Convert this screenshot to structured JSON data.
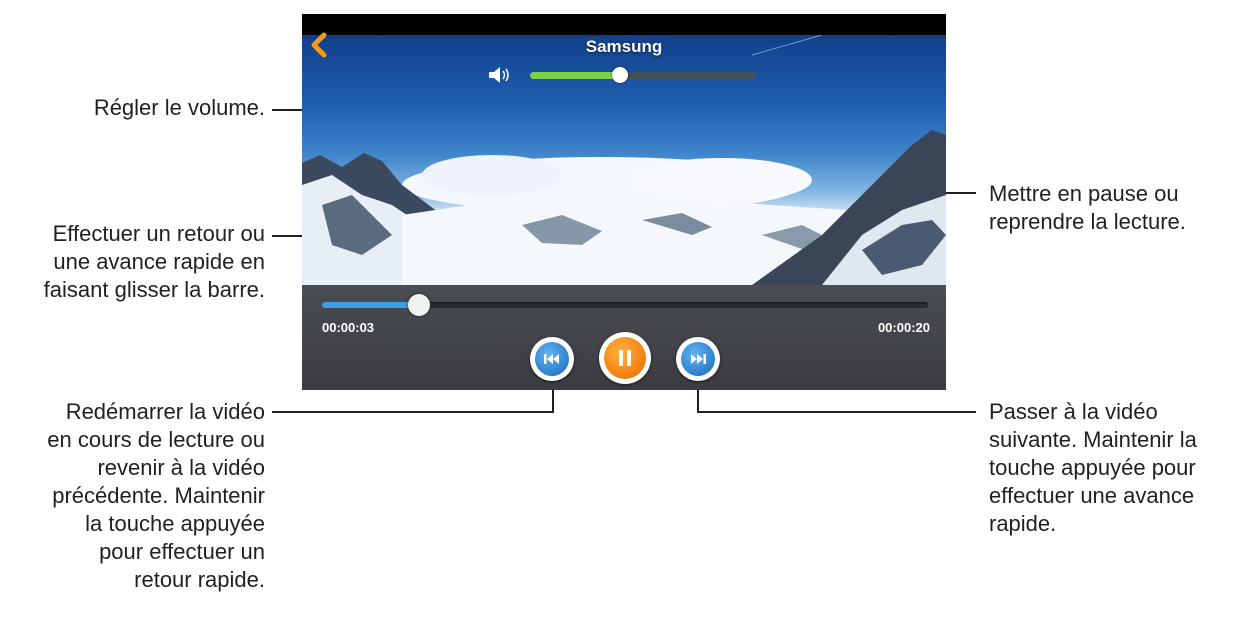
{
  "player": {
    "title": "Samsung",
    "back_icon": "chevron-left-icon",
    "volume_icon": "speaker-icon",
    "volume_level": 0.4,
    "seek_progress": 0.16,
    "time_elapsed": "00:00:03",
    "time_total": "00:00:20",
    "colors": {
      "accent_orange": "#f07e10",
      "accent_blue": "#2f7fcc",
      "volume_green": "#7bd04a",
      "seek_blue": "#3aa0e8"
    }
  },
  "callouts": {
    "volume": "Régler le volume.",
    "seek": "Effectuer un retour ou une avance rapide en faisant glisser la barre.",
    "seek_lines": [
      "Effectuer un retour ou",
      "une avance rapide en",
      "faisant glisser la barre."
    ],
    "pause_lines": [
      "Mettre en pause ou",
      "reprendre la lecture."
    ],
    "previous_lines": [
      "Redémarrer la vidéo",
      "en cours de lecture ou",
      "revenir à la vidéo",
      "précédente. Maintenir",
      "la touche appuyée",
      "pour effectuer un",
      "retour rapide."
    ],
    "next_lines": [
      "Passer à la vidéo",
      "suivante. Maintenir la",
      "touche appuyée pour",
      "effectuer une avance",
      "rapide."
    ]
  }
}
